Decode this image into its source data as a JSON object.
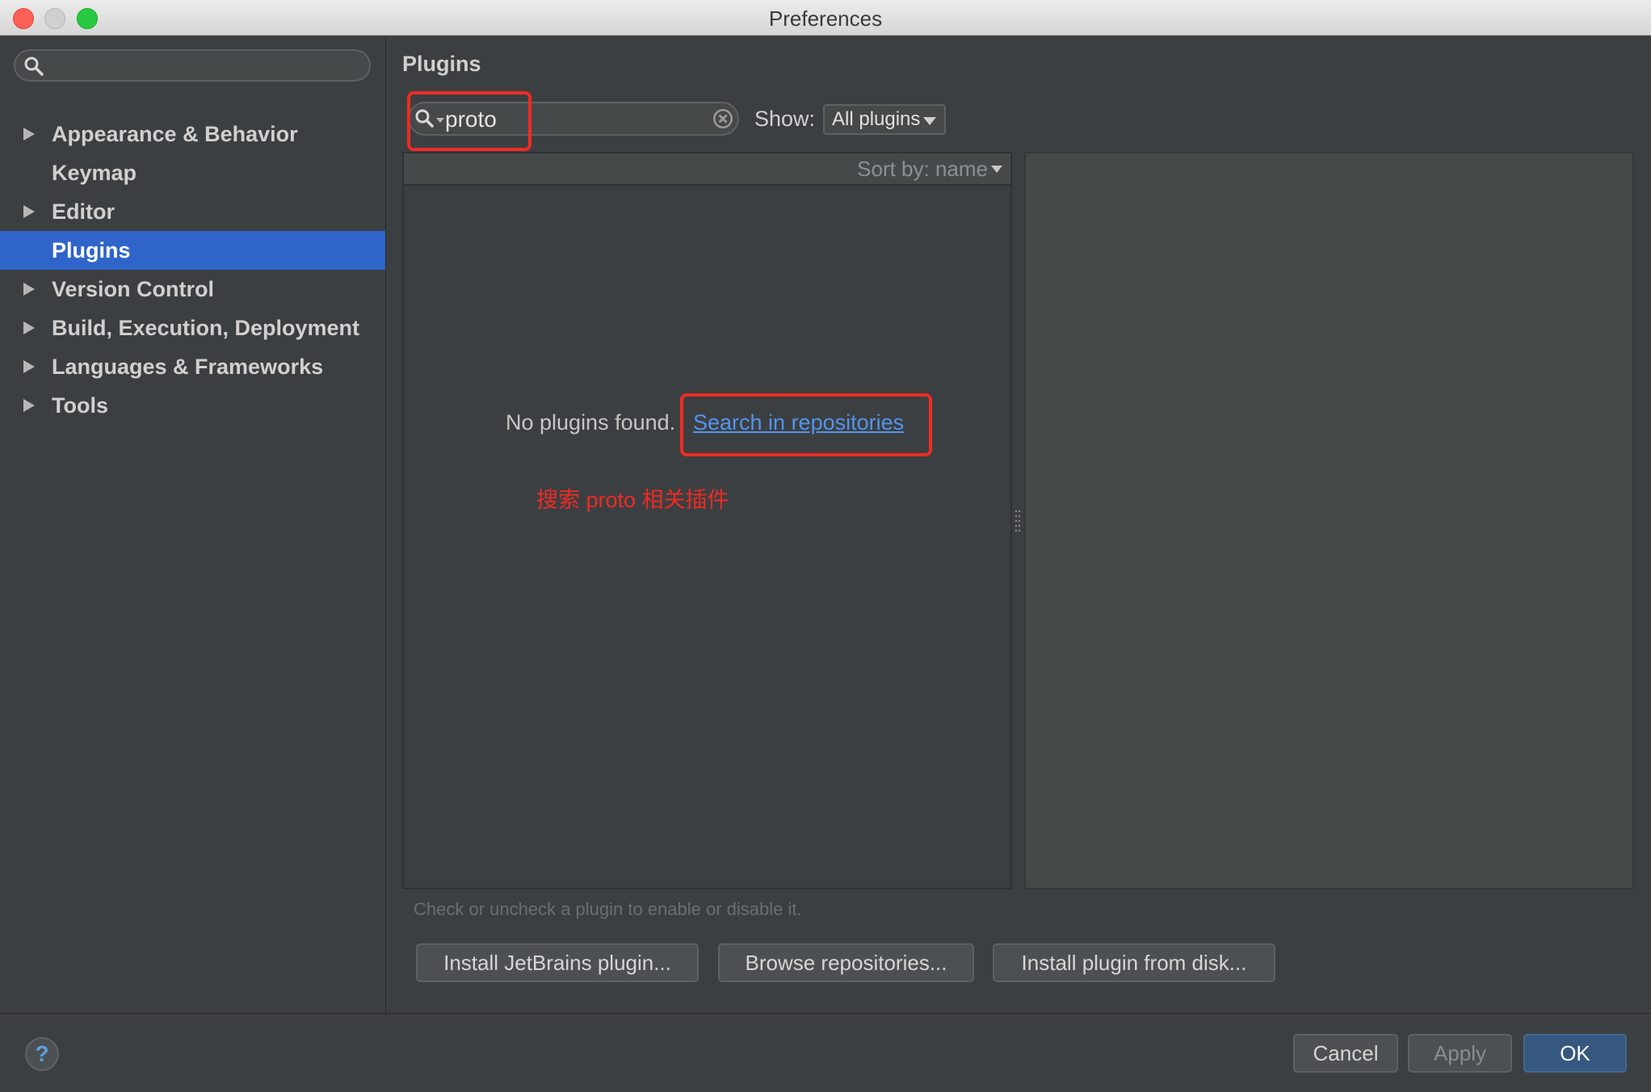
{
  "window": {
    "title": "Preferences"
  },
  "sidebar": {
    "search": {
      "value": "",
      "placeholder": ""
    },
    "items": [
      {
        "label": "Appearance & Behavior",
        "expandable": true
      },
      {
        "label": "Keymap",
        "expandable": false
      },
      {
        "label": "Editor",
        "expandable": true
      },
      {
        "label": "Plugins",
        "expandable": false,
        "selected": true
      },
      {
        "label": "Version Control",
        "expandable": true
      },
      {
        "label": "Build, Execution, Deployment",
        "expandable": true
      },
      {
        "label": "Languages & Frameworks",
        "expandable": true
      },
      {
        "label": "Tools",
        "expandable": true
      }
    ]
  },
  "main": {
    "title": "Plugins",
    "search": {
      "value": "proto"
    },
    "show": {
      "label": "Show:",
      "selected": "All plugins"
    },
    "sort": {
      "label": "Sort by: name"
    },
    "empty": {
      "message": "No plugins found.",
      "link": "Search in repositories"
    },
    "annotation": "搜索 proto 相关插件",
    "hint": "Check or uncheck a plugin to enable or disable it.",
    "buttons": {
      "install_jetbrains": "Install JetBrains plugin...",
      "browse": "Browse repositories...",
      "install_disk": "Install plugin from disk..."
    }
  },
  "footer": {
    "help": "?",
    "cancel": "Cancel",
    "apply": "Apply",
    "ok": "OK"
  },
  "colors": {
    "accent": "#2f65ca",
    "link": "#5394ec",
    "annotation": "#ee2b24",
    "background": "#3c3f41"
  },
  "icons": {
    "search": "search-icon",
    "clear": "clear-icon",
    "dropdown": "chevron-down-icon",
    "help": "help-icon"
  }
}
